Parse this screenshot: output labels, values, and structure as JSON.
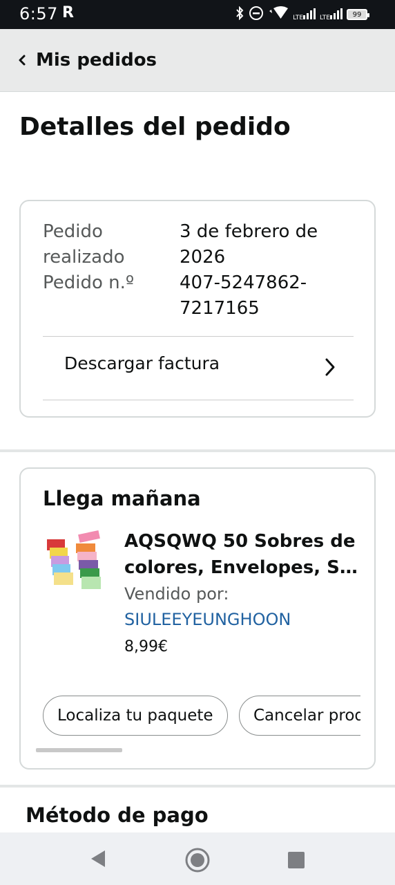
{
  "status_bar": {
    "time": "6:57",
    "r_icon": "R",
    "battery": "99",
    "icons": [
      "bluetooth-icon",
      "dnd-icon",
      "wifi-icon",
      "lte-signal-icon",
      "lte-signal-icon",
      "battery-icon"
    ],
    "lte_1": "LTE",
    "lte_2": "LTE"
  },
  "header": {
    "back_icon": "chevron-left-icon",
    "title": "Mis pedidos"
  },
  "page_title": "Detalles del pedido",
  "order_info": {
    "placed_label": "Pedido realizado",
    "placed_label_l1": "Pedido",
    "placed_label_l2": "realizado",
    "placed_value_l1": "3 de febrero de",
    "placed_value_l2": "2026",
    "number_label": "Pedido n.º",
    "number_value_l1": "407-5247862-",
    "number_value_l2": "7217165",
    "invoice_label": "Descargar factura"
  },
  "shipment": {
    "status": "Llega mañana",
    "product_title_l1": "AQSQWQ 50 Sobres de",
    "product_title_l2": "colores, Envelopes, Sobres de colores",
    "sold_by_label": "Vendido por:",
    "seller": "SIULEEYEUNGHOON",
    "price": "8,99€",
    "buttons": [
      "Localiza tu paquete",
      "Cancelar productos"
    ]
  },
  "payment": {
    "title": "Método de pago"
  },
  "colors": {
    "link": "#2162a1",
    "header_bg": "#e9eaea",
    "status_bar_bg": "#111418"
  }
}
